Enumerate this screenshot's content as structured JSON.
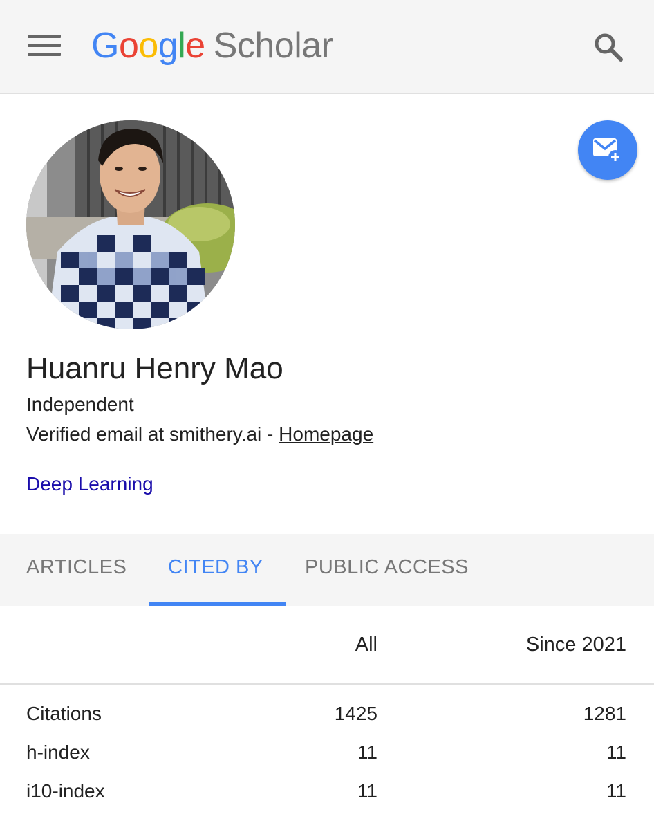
{
  "header": {
    "menu_icon": "hamburger-menu-icon",
    "logo_letters": [
      {
        "ch": "G",
        "color": "#4285f4"
      },
      {
        "ch": "o",
        "color": "#ea4335"
      },
      {
        "ch": "o",
        "color": "#fbbc05"
      },
      {
        "ch": "g",
        "color": "#4285f4"
      },
      {
        "ch": "l",
        "color": "#34a853"
      },
      {
        "ch": "e",
        "color": "#ea4335"
      }
    ],
    "logo_suffix": "Scholar",
    "search_icon": "search-icon"
  },
  "profile": {
    "name": "Huanru Henry Mao",
    "affiliation": "Independent",
    "email_text": "Verified email at smithery.ai - ",
    "homepage_label": "Homepage",
    "interests": [
      "Deep Learning"
    ],
    "follow_icon": "email-add-icon"
  },
  "tabs": [
    {
      "label": "ARTICLES",
      "active": false
    },
    {
      "label": "CITED BY",
      "active": true
    },
    {
      "label": "PUBLIC ACCESS",
      "active": false
    }
  ],
  "stats": {
    "columns": [
      "All",
      "Since 2021"
    ],
    "rows": [
      {
        "label": "Citations",
        "all": "1425",
        "since": "1281"
      },
      {
        "label": "h-index",
        "all": "11",
        "since": "11"
      },
      {
        "label": "i10-index",
        "all": "11",
        "since": "11"
      }
    ]
  },
  "colors": {
    "accent": "#4285f4",
    "link": "#1a0dab",
    "appbar_bg": "#f5f5f5"
  }
}
